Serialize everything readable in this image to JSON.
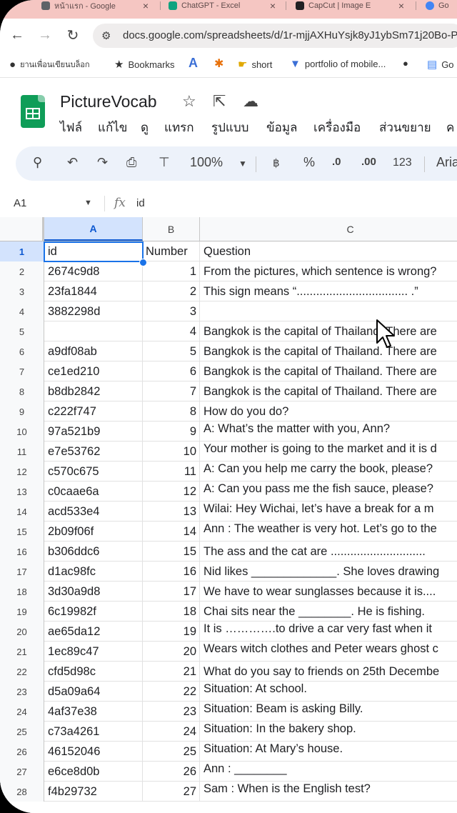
{
  "browser": {
    "tabs": [
      {
        "label": "หน้าแรก - Google",
        "icon_color": "#5f6368"
      },
      {
        "label": "ChatGPT - Excel",
        "icon_color": "#10a37f"
      },
      {
        "label": "CapCut | Image E",
        "icon_color": "#202124"
      },
      {
        "label": "Go",
        "icon_color": "#4285f4"
      }
    ],
    "url": "docs.google.com/spreadsheets/d/1r-mjjAXHuYsjk8yJ1ybSm71j20Bo-P",
    "bookmarks": [
      {
        "label": "ยานเพื่อนเขียนบล็อก",
        "icon": "github-icon"
      },
      {
        "label": "Bookmarks",
        "icon": "star-icon"
      },
      {
        "label": "",
        "icon": "font-a-icon"
      },
      {
        "label": "",
        "icon": "pinwheel-icon"
      },
      {
        "label": "short",
        "icon": "hand-icon"
      },
      {
        "label": "portfolio of mobile...",
        "icon": "filter-icon"
      },
      {
        "label": "",
        "icon": "github-icon"
      },
      {
        "label": "Go",
        "icon": "docs-icon"
      }
    ]
  },
  "sheet": {
    "title": "PictureVocab",
    "menu": [
      "ไฟล์",
      "แก้ไข",
      "ดู",
      "แทรก",
      "รูปแบบ",
      "ข้อมูล",
      "เครื่องมือ",
      "ส่วนขยาย",
      "ค"
    ],
    "toolbar": {
      "zoom": "100%",
      "percent": "%",
      "decrease_decimal": ".0",
      "increase_decimal": ".00",
      "number_format": "123",
      "font": "Aria"
    },
    "name_box": "A1",
    "formula": "id",
    "columns": [
      "A",
      "B",
      "C"
    ],
    "rows": [
      {
        "n": "1",
        "a": "id",
        "b": "Number",
        "c": "Question"
      },
      {
        "n": "2",
        "a": "2674c9d8",
        "b": "1",
        "c": "From the pictures, which sentence is wrong?"
      },
      {
        "n": "3",
        "a": "23fa1844",
        "b": "2",
        "c": "This sign means “.................................. .”"
      },
      {
        "n": "4",
        "a": "3882298d",
        "b": "3",
        "c": ""
      },
      {
        "n": "5",
        "a": "",
        "b": "4",
        "c": "Bangkok is the capital of Thailand. There are"
      },
      {
        "n": "6",
        "a": "a9df08ab",
        "b": "5",
        "c": "Bangkok is the capital of Thailand. There are"
      },
      {
        "n": "7",
        "a": "ce1ed210",
        "b": "6",
        "c": "Bangkok is the capital of Thailand. There are"
      },
      {
        "n": "8",
        "a": "b8db2842",
        "b": "7",
        "c": "Bangkok is the capital of Thailand. There are"
      },
      {
        "n": "9",
        "a": "c222f747",
        "b": "8",
        "c": "How do you do?"
      },
      {
        "n": "10",
        "a": "97a521b9",
        "b": "9",
        "c": "A: What’s the matter with you, Ann?"
      },
      {
        "n": "11",
        "a": "e7e53762",
        "b": "10",
        "c": "Your mother is going to the market and it is d"
      },
      {
        "n": "12",
        "a": "c570c675",
        "b": "11",
        "c": "A: Can you help me carry the book, please?"
      },
      {
        "n": "13",
        "a": "c0caae6a",
        "b": "12",
        "c": "A: Can you pass me the fish sauce, please?"
      },
      {
        "n": "14",
        "a": "acd533e4",
        "b": "13",
        "c": "Wilai: Hey Wichai, let’s have a break for a m"
      },
      {
        "n": "15",
        "a": "2b09f06f",
        "b": "14",
        "c": "Ann : The weather is very hot. Let’s go to the"
      },
      {
        "n": "16",
        "a": "b306ddc6",
        "b": "15",
        "c": "The ass and the cat are ............................."
      },
      {
        "n": "17",
        "a": "d1ac98fc",
        "b": "16",
        "c": "Nid likes _____________. She loves drawing"
      },
      {
        "n": "18",
        "a": "3d30a9d8",
        "b": "17",
        "c": "We have to wear sunglasses because it is...."
      },
      {
        "n": "19",
        "a": "6c19982f",
        "b": "18",
        "c": "Chai sits near the ________. He is fishing."
      },
      {
        "n": "20",
        "a": "ae65da12",
        "b": "19",
        "c": "It is ………….to drive a car very fast when it"
      },
      {
        "n": "21",
        "a": "1ec89c47",
        "b": "20",
        "c": "Wears witch clothes and Peter wears ghost c"
      },
      {
        "n": "22",
        "a": "cfd5d98c",
        "b": "21",
        "c": "What do you say to friends on 25th Decembe"
      },
      {
        "n": "23",
        "a": "d5a09a64",
        "b": "22",
        "c": "Situation: At school."
      },
      {
        "n": "24",
        "a": "4af37e38",
        "b": "23",
        "c": "Situation: Beam is asking Billy."
      },
      {
        "n": "25",
        "a": "c73a4261",
        "b": "24",
        "c": "Situation: In the bakery shop."
      },
      {
        "n": "26",
        "a": "46152046",
        "b": "25",
        "c": "Situation: At Mary’s house."
      },
      {
        "n": "27",
        "a": "e6ce8d0b",
        "b": "26",
        "c": "Ann : ________"
      },
      {
        "n": "28",
        "a": "f4b29732",
        "b": "27",
        "c": "Sam : When is the English test?"
      }
    ]
  },
  "colors": {
    "tab_strip": "#f5c6c2",
    "selection": "#1a73e8",
    "sheets_green": "#0f9d58",
    "toolbar_bg": "#edf2fa"
  }
}
